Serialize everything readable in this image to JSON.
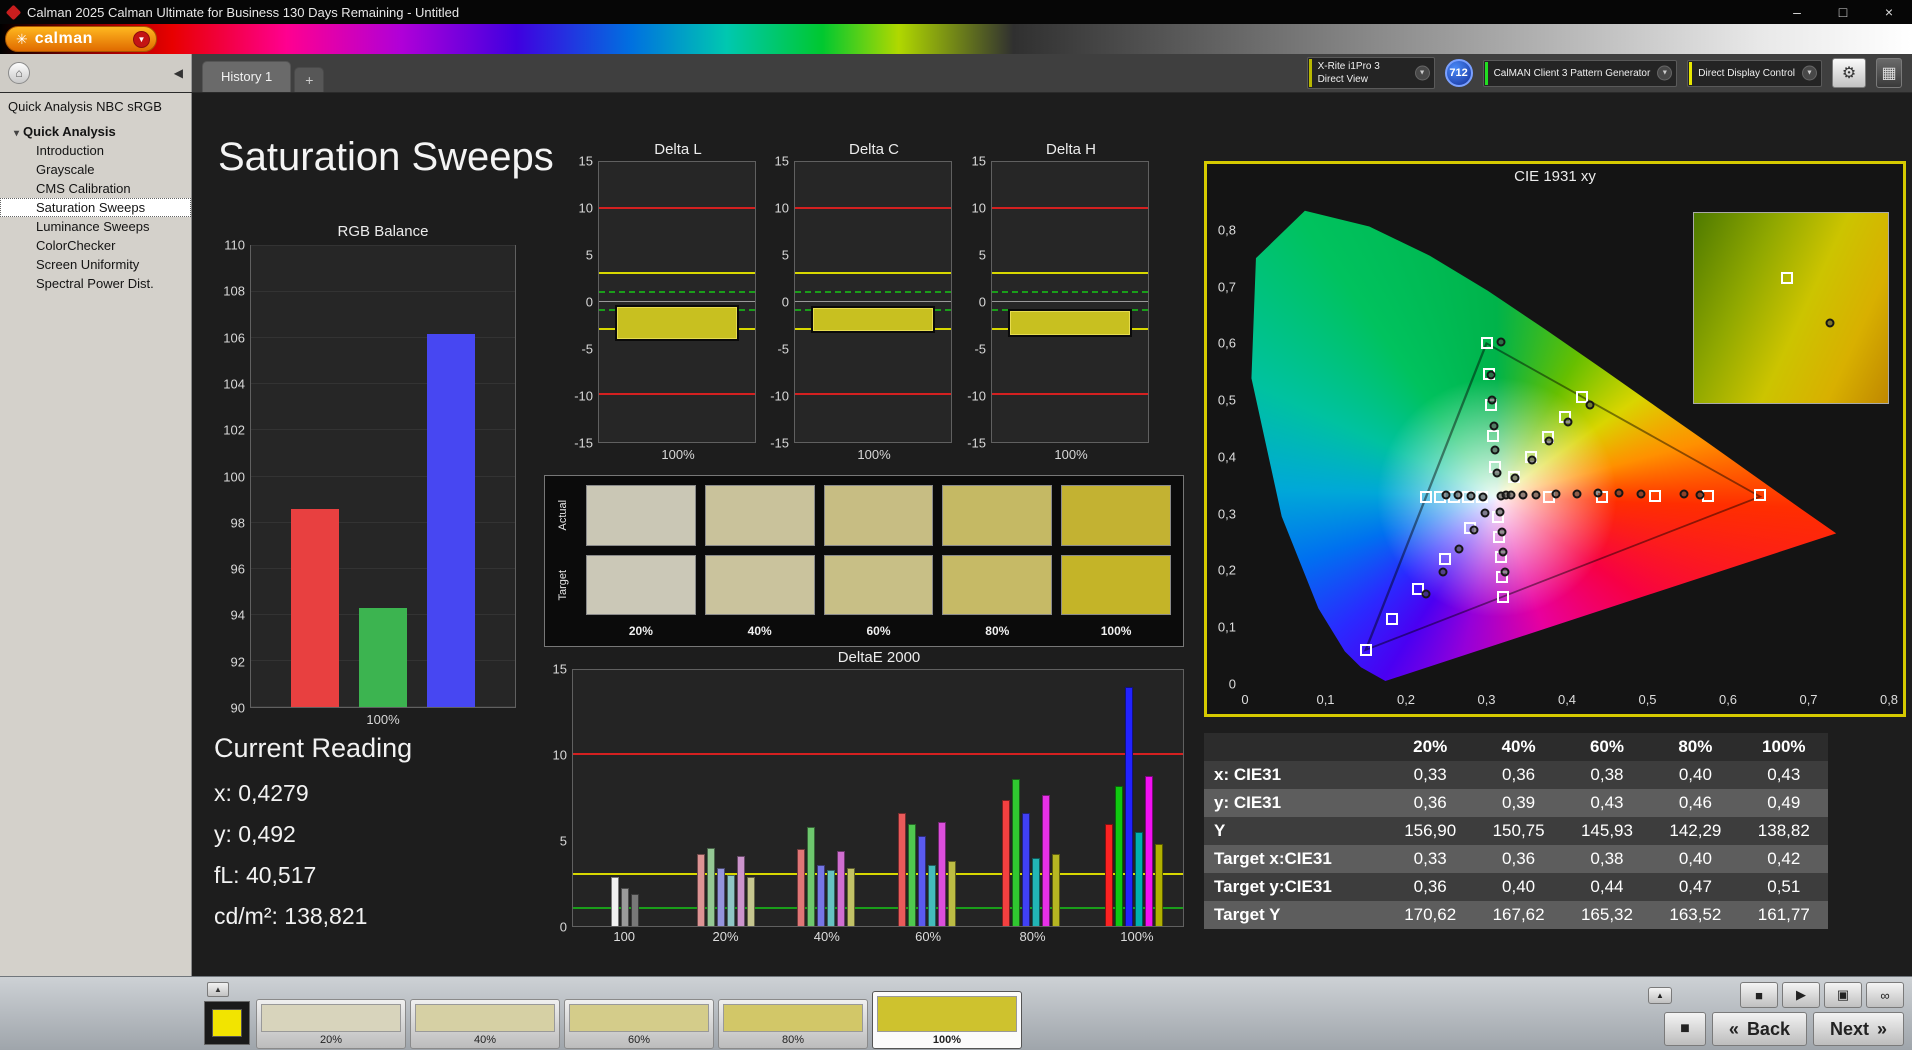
{
  "window": {
    "title": "Calman 2025 Calman Ultimate for Business 130 Days Remaining  - Untitled"
  },
  "icons": {
    "minimize": "–",
    "maximize": "□",
    "close": "×",
    "caret": "▼",
    "logo_star": "✳",
    "home": "⌂",
    "collapse": "◀",
    "expander": "▾",
    "tab_add": "+",
    "gear": "⚙",
    "grid": "▦",
    "eject": "▲",
    "stop": "■",
    "play": "▶",
    "save": "▣",
    "loop": "∞",
    "big_stop": "■",
    "back_chevron": "«",
    "next_chevron": "»"
  },
  "brand": {
    "logo_text": "calman"
  },
  "tabs": {
    "active": "History 1"
  },
  "devices": {
    "meter_line1": "X-Rite i1Pro 3",
    "meter_line2": "Direct View",
    "badge": "712",
    "pattern": "CalMAN Client 3 Pattern Generator",
    "display": "Direct Display Control"
  },
  "sidebar": {
    "header": "Quick Analysis NBC sRGB",
    "root": "Quick Analysis",
    "selected": "Saturation Sweeps",
    "items": [
      "Introduction",
      "Grayscale",
      "CMS Calibration",
      "Saturation Sweeps",
      "Luminance Sweeps",
      "ColorChecker",
      "Screen Uniformity",
      "Spectral Power Dist."
    ]
  },
  "page": {
    "title": "Saturation Sweeps"
  },
  "current_reading": {
    "title": "Current Reading",
    "lines": [
      "x: 0,4279",
      "y: 0,492",
      "fL: 40,517",
      "cd/m²: 138,821"
    ]
  },
  "bottom": {
    "selected_patch": "100%",
    "back_label": "Back",
    "next_label": "Next",
    "sample_color": "#f2e400",
    "patches": [
      {
        "label": "20%",
        "color": "#d8d4bc"
      },
      {
        "label": "40%",
        "color": "#d6d0a4"
      },
      {
        "label": "60%",
        "color": "#d4cc8a"
      },
      {
        "label": "80%",
        "color": "#d2c768"
      },
      {
        "label": "100%",
        "color": "#cec22e"
      }
    ]
  },
  "chart_data": [
    {
      "id": "rgb_balance",
      "type": "bar",
      "title": "RGB Balance",
      "categories": [
        "Red",
        "Green",
        "Blue"
      ],
      "values": [
        98.6,
        94.3,
        106.2
      ],
      "colors": [
        "#e84040",
        "#3cb450",
        "#4747f2"
      ],
      "ylim": [
        90,
        110
      ],
      "yticks": [
        90,
        92,
        94,
        96,
        98,
        100,
        102,
        104,
        106,
        108,
        110
      ],
      "xlabel": "100%"
    },
    {
      "id": "delta_l",
      "type": "bar",
      "title": "Delta L",
      "ylim": [
        -15,
        15
      ],
      "yticks": [
        -15,
        -10,
        -5,
        0,
        5,
        10,
        15
      ],
      "bar": {
        "from": -0.3,
        "to": -4.2
      },
      "bar_color": "#c8c020",
      "ref_lines": [
        {
          "y": 10,
          "color": "#d42020"
        },
        {
          "y": -10,
          "color": "#d42020"
        },
        {
          "y": 3,
          "color": "#d8d800"
        },
        {
          "y": -3,
          "color": "#d8d800"
        },
        {
          "y": 1,
          "color": "#1a9e1a",
          "dash": true
        },
        {
          "y": -1,
          "color": "#1a9e1a",
          "dash": true
        }
      ],
      "xlabel": "100%"
    },
    {
      "id": "delta_c",
      "type": "bar",
      "title": "Delta C",
      "ylim": [
        -15,
        15
      ],
      "yticks": [
        -15,
        -10,
        -5,
        0,
        5,
        10,
        15
      ],
      "bar": {
        "from": -0.4,
        "to": -3.3
      },
      "bar_color": "#c8c020",
      "ref_lines": [
        {
          "y": 10,
          "color": "#d42020"
        },
        {
          "y": -10,
          "color": "#d42020"
        },
        {
          "y": 3,
          "color": "#d8d800"
        },
        {
          "y": -3,
          "color": "#d8d800"
        },
        {
          "y": 1,
          "color": "#1a9e1a",
          "dash": true
        },
        {
          "y": -1,
          "color": "#1a9e1a",
          "dash": true
        }
      ],
      "xlabel": "100%"
    },
    {
      "id": "delta_h",
      "type": "bar",
      "title": "Delta H",
      "ylim": [
        -15,
        15
      ],
      "yticks": [
        -15,
        -10,
        -5,
        0,
        5,
        10,
        15
      ],
      "bar": {
        "from": -0.8,
        "to": -3.8
      },
      "bar_color": "#c8c020",
      "ref_lines": [
        {
          "y": 10,
          "color": "#d42020"
        },
        {
          "y": -10,
          "color": "#d42020"
        },
        {
          "y": 3,
          "color": "#d8d800"
        },
        {
          "y": -3,
          "color": "#d8d800"
        },
        {
          "y": 1,
          "color": "#1a9e1a",
          "dash": true
        },
        {
          "y": -1,
          "color": "#1a9e1a",
          "dash": true
        }
      ],
      "xlabel": "100%"
    },
    {
      "id": "swatches",
      "type": "table",
      "row_labels": [
        "Actual",
        "Target"
      ],
      "col_labels": [
        "20%",
        "40%",
        "60%",
        "80%",
        "100%"
      ],
      "actual_colors": [
        "#cac7b5",
        "#c9c29b",
        "#c7bd83",
        "#c5b964",
        "#c3b232"
      ],
      "target_colors": [
        "#cbc8b7",
        "#cac39d",
        "#c8bf86",
        "#c6ba66",
        "#c4b428"
      ]
    },
    {
      "id": "deltae",
      "type": "bar",
      "title": "DeltaE 2000",
      "ylim": [
        0,
        15
      ],
      "yticks": [
        0,
        5,
        10,
        15
      ],
      "ref_lines": [
        {
          "y": 10,
          "color": "#d42020"
        },
        {
          "y": 3,
          "color": "#d8d800"
        },
        {
          "y": 1,
          "color": "#1a9e1a"
        }
      ],
      "group_positions": [
        8.5,
        25,
        41.5,
        58,
        75,
        92
      ],
      "groups": [
        {
          "label": "100",
          "bars": [
            {
              "v": 2.9,
              "c": "#f2f2f2"
            },
            {
              "v": 2.2,
              "c": "#9a9a9a"
            },
            {
              "v": 1.9,
              "c": "#787878"
            }
          ]
        },
        {
          "label": "20%",
          "bars": [
            {
              "v": 4.2,
              "c": "#dd9494"
            },
            {
              "v": 4.6,
              "c": "#94c894"
            },
            {
              "v": 3.4,
              "c": "#9494dd"
            },
            {
              "v": 3.0,
              "c": "#8fc6c6"
            },
            {
              "v": 4.1,
              "c": "#cc94cc"
            },
            {
              "v": 2.9,
              "c": "#c6c68f"
            }
          ]
        },
        {
          "label": "40%",
          "bars": [
            {
              "v": 4.5,
              "c": "#e07676"
            },
            {
              "v": 5.8,
              "c": "#6ec86e"
            },
            {
              "v": 3.6,
              "c": "#7676e6"
            },
            {
              "v": 3.3,
              "c": "#66c2c2"
            },
            {
              "v": 4.4,
              "c": "#d06ed0"
            },
            {
              "v": 3.4,
              "c": "#c2c266"
            }
          ]
        },
        {
          "label": "60%",
          "bars": [
            {
              "v": 6.6,
              "c": "#ea5a5a"
            },
            {
              "v": 6.0,
              "c": "#4fc84f"
            },
            {
              "v": 5.3,
              "c": "#5a5aef"
            },
            {
              "v": 3.6,
              "c": "#44bcbc"
            },
            {
              "v": 6.1,
              "c": "#dc4fdc"
            },
            {
              "v": 3.8,
              "c": "#bcbc44"
            }
          ]
        },
        {
          "label": "80%",
          "bars": [
            {
              "v": 7.4,
              "c": "#f34040"
            },
            {
              "v": 8.6,
              "c": "#30c830"
            },
            {
              "v": 6.6,
              "c": "#4040f6"
            },
            {
              "v": 4.0,
              "c": "#22b6b6"
            },
            {
              "v": 7.7,
              "c": "#e830e8"
            },
            {
              "v": 4.2,
              "c": "#b6b622"
            }
          ]
        },
        {
          "label": "100%",
          "bars": [
            {
              "v": 6.0,
              "c": "#fb2222"
            },
            {
              "v": 8.2,
              "c": "#10c810"
            },
            {
              "v": 14.0,
              "c": "#2222ff"
            },
            {
              "v": 5.5,
              "c": "#00b0b0"
            },
            {
              "v": 8.8,
              "c": "#f210f2"
            },
            {
              "v": 4.8,
              "c": "#b0b000"
            }
          ]
        }
      ]
    },
    {
      "id": "cie",
      "type": "scatter",
      "title": "CIE 1931 xy",
      "xlim": [
        0,
        0.8
      ],
      "ylim": [
        0,
        0.87
      ],
      "xticks": [
        "0",
        "0,1",
        "0,2",
        "0,3",
        "0,4",
        "0,5",
        "0,6",
        "0,7",
        "0,8"
      ],
      "yticks": [
        "0",
        "0,1",
        "0,2",
        "0,3",
        "0,4",
        "0,5",
        "0,6",
        "0,7",
        "0,8"
      ],
      "white_point": [
        0.3127,
        0.329
      ],
      "srgb_triangle": [
        [
          0.64,
          0.33
        ],
        [
          0.3,
          0.6
        ],
        [
          0.15,
          0.06
        ]
      ],
      "targets": [
        [
          0.378,
          0.33
        ],
        [
          0.444,
          0.33
        ],
        [
          0.509,
          0.331
        ],
        [
          0.575,
          0.331
        ],
        [
          0.64,
          0.332
        ],
        [
          0.31,
          0.383
        ],
        [
          0.308,
          0.437
        ],
        [
          0.305,
          0.492
        ],
        [
          0.303,
          0.546
        ],
        [
          0.3,
          0.6
        ],
        [
          0.28,
          0.275
        ],
        [
          0.248,
          0.221
        ],
        [
          0.215,
          0.168
        ],
        [
          0.183,
          0.114
        ],
        [
          0.15,
          0.06
        ],
        [
          0.295,
          0.329
        ],
        [
          0.277,
          0.329
        ],
        [
          0.26,
          0.329
        ],
        [
          0.242,
          0.329
        ],
        [
          0.225,
          0.329
        ],
        [
          0.314,
          0.294
        ],
        [
          0.316,
          0.259
        ],
        [
          0.318,
          0.224
        ],
        [
          0.319,
          0.189
        ],
        [
          0.321,
          0.154
        ],
        [
          0.334,
          0.364
        ],
        [
          0.355,
          0.4
        ],
        [
          0.377,
          0.435
        ],
        [
          0.398,
          0.47
        ],
        [
          0.419,
          0.505
        ]
      ],
      "measurements": [
        [
          0.318,
          0.331
        ],
        [
          0.324,
          0.332
        ],
        [
          0.33,
          0.333
        ],
        [
          0.345,
          0.332
        ],
        [
          0.362,
          0.333
        ],
        [
          0.386,
          0.334
        ],
        [
          0.412,
          0.335
        ],
        [
          0.438,
          0.336
        ],
        [
          0.465,
          0.336
        ],
        [
          0.492,
          0.335
        ],
        [
          0.545,
          0.334
        ],
        [
          0.565,
          0.333
        ],
        [
          0.313,
          0.372
        ],
        [
          0.311,
          0.412
        ],
        [
          0.309,
          0.455
        ],
        [
          0.307,
          0.5
        ],
        [
          0.305,
          0.545
        ],
        [
          0.318,
          0.603
        ],
        [
          0.298,
          0.301
        ],
        [
          0.284,
          0.272
        ],
        [
          0.266,
          0.237
        ],
        [
          0.246,
          0.198
        ],
        [
          0.225,
          0.158
        ],
        [
          0.296,
          0.33
        ],
        [
          0.281,
          0.331
        ],
        [
          0.265,
          0.332
        ],
        [
          0.25,
          0.333
        ],
        [
          0.317,
          0.303
        ],
        [
          0.319,
          0.268
        ],
        [
          0.321,
          0.232
        ],
        [
          0.323,
          0.197
        ],
        [
          0.336,
          0.362
        ],
        [
          0.356,
          0.395
        ],
        [
          0.378,
          0.428
        ],
        [
          0.401,
          0.461
        ],
        [
          0.428,
          0.492
        ]
      ]
    },
    {
      "id": "sat_table",
      "type": "table",
      "col_headers": [
        "",
        "20%",
        "40%",
        "60%",
        "80%",
        "100%"
      ],
      "rows": [
        {
          "label": "x: CIE31",
          "values": [
            "0,33",
            "0,36",
            "0,38",
            "0,40",
            "0,43"
          ]
        },
        {
          "label": "y: CIE31",
          "values": [
            "0,36",
            "0,39",
            "0,43",
            "0,46",
            "0,49"
          ]
        },
        {
          "label": "Y",
          "values": [
            "156,90",
            "150,75",
            "145,93",
            "142,29",
            "138,82"
          ]
        },
        {
          "label": "Target x:CIE31",
          "values": [
            "0,33",
            "0,36",
            "0,38",
            "0,40",
            "0,42"
          ]
        },
        {
          "label": "Target y:CIE31",
          "values": [
            "0,36",
            "0,40",
            "0,44",
            "0,47",
            "0,51"
          ]
        },
        {
          "label": "Target Y",
          "values": [
            "170,62",
            "167,62",
            "165,32",
            "163,52",
            "161,77"
          ]
        }
      ]
    }
  ]
}
